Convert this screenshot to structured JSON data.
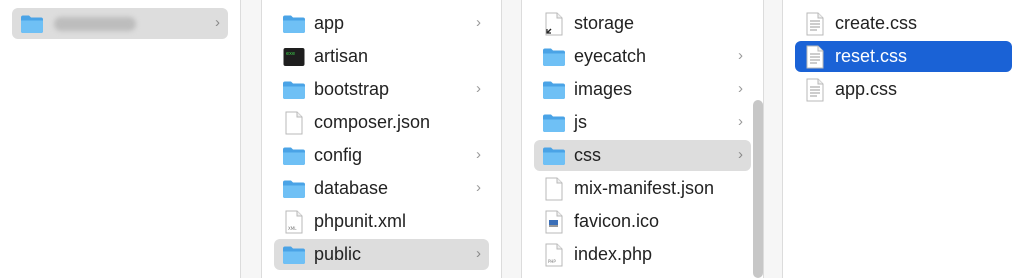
{
  "columns": [
    {
      "items": [
        {
          "label": "",
          "icon": "folder-icon",
          "blurred": true,
          "chevron": "›",
          "selected": "gray"
        }
      ]
    },
    {
      "items": [
        {
          "label": "app",
          "icon": "folder-icon",
          "chevron": "›"
        },
        {
          "label": "artisan",
          "icon": "terminal-icon"
        },
        {
          "label": "bootstrap",
          "icon": "folder-icon",
          "chevron": "›"
        },
        {
          "label": "composer.json",
          "icon": "document-icon"
        },
        {
          "label": "config",
          "icon": "folder-icon",
          "chevron": "›"
        },
        {
          "label": "database",
          "icon": "folder-icon",
          "chevron": "›"
        },
        {
          "label": "phpunit.xml",
          "icon": "xml-file-icon"
        },
        {
          "label": "public",
          "icon": "folder-icon",
          "chevron": "›",
          "selected": "gray"
        }
      ]
    },
    {
      "items": [
        {
          "label": "storage",
          "icon": "alias-icon"
        },
        {
          "label": "eyecatch",
          "icon": "folder-icon",
          "chevron": "›"
        },
        {
          "label": "images",
          "icon": "folder-icon",
          "chevron": "›"
        },
        {
          "label": "js",
          "icon": "folder-icon",
          "chevron": "›"
        },
        {
          "label": "css",
          "icon": "folder-icon",
          "chevron": "›",
          "selected": "gray"
        },
        {
          "label": "mix-manifest.json",
          "icon": "document-icon"
        },
        {
          "label": "favicon.ico",
          "icon": "ico-file-icon"
        },
        {
          "label": "index.php",
          "icon": "php-file-icon"
        }
      ]
    },
    {
      "items": [
        {
          "label": "create.css",
          "icon": "text-file-icon"
        },
        {
          "label": "reset.css",
          "icon": "text-file-icon",
          "selected": "blue"
        },
        {
          "label": "app.css",
          "icon": "text-file-icon"
        }
      ]
    }
  ],
  "colors": {
    "selection_blue": "#1a62d6",
    "selection_gray": "#dddddd",
    "folder_blue": "#5ab2ef"
  }
}
